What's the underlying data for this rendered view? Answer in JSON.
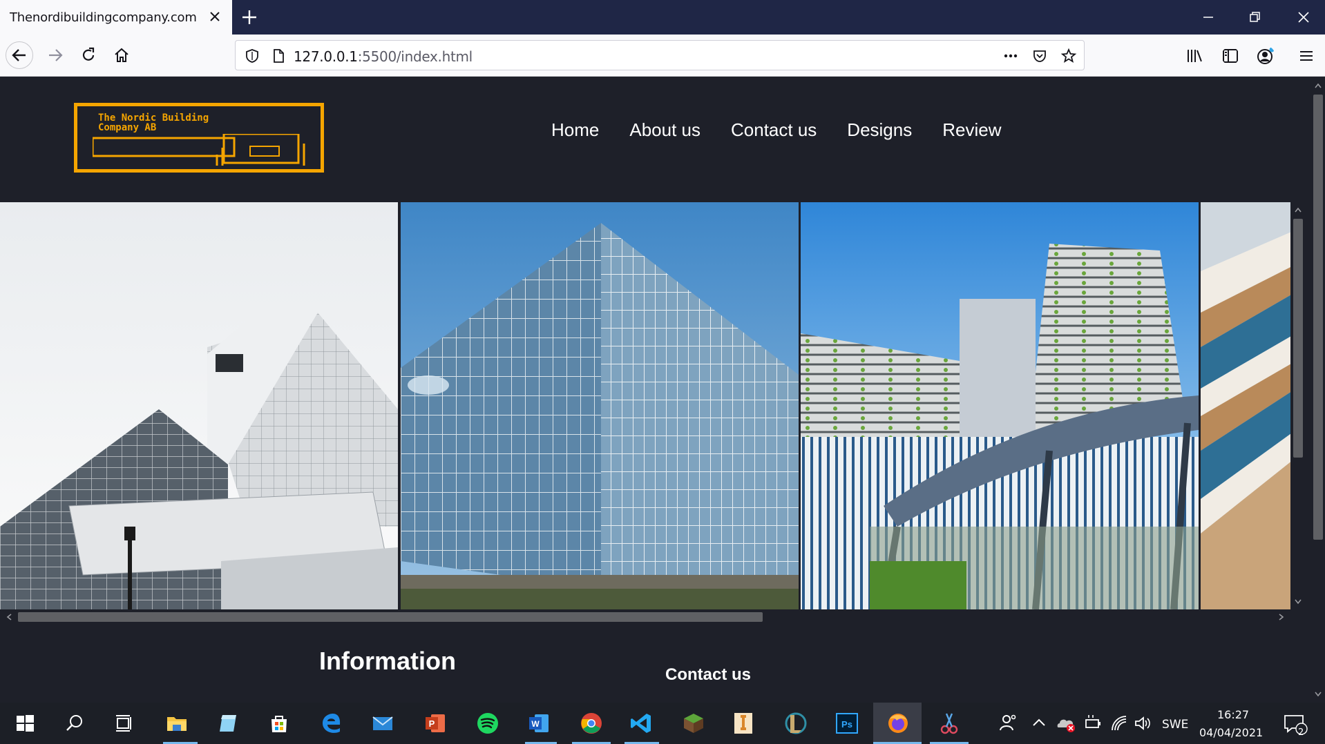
{
  "browser": {
    "tab_title": "Thenordibuildingcompany.com",
    "url_host": "127.0.0.1",
    "url_rest": ":5500/index.html"
  },
  "site": {
    "logo_line1": "The Nordic Building",
    "logo_line2": "Company AB",
    "nav": [
      "Home",
      "About us",
      "Contact us",
      "Designs",
      "Review"
    ],
    "info_heading": "Information",
    "contact_heading": "Contact us"
  },
  "taskbar": {
    "language": "SWE",
    "time": "16:27",
    "date": "04/04/2021",
    "notification_count": "2"
  }
}
